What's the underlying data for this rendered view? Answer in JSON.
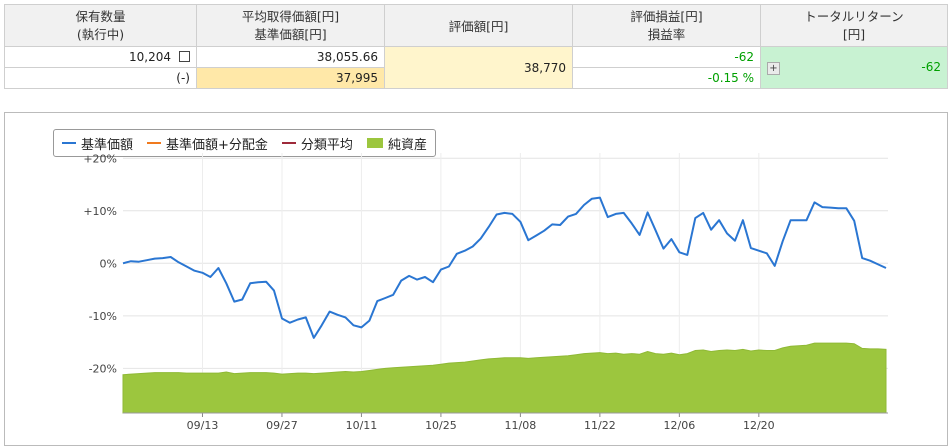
{
  "summary": {
    "headers": {
      "qty": [
        "保有数量",
        "(執行中)"
      ],
      "avg": [
        "平均取得価額[円]",
        "基準価額[円]"
      ],
      "valuation": "評価額[円]",
      "pl": [
        "評価損益[円]",
        "損益率"
      ],
      "total_return": [
        "トータルリターン",
        "[円]"
      ]
    },
    "qty": "10,204",
    "qty_pending": "(-)",
    "avg_cost": "38,055.66",
    "nav": "37,995",
    "valuation": "38,770",
    "pl": "-62",
    "pl_rate": "-0.15 %",
    "total_return": "-62",
    "colors": {
      "positive_text": "#00a000",
      "nav_bg": "#ffe8a8",
      "valuation_bg": "#fff5cc",
      "total_bg": "#c8f2d2"
    }
  },
  "chart_data": {
    "type": "line",
    "legend": [
      {
        "name": "基準価額",
        "color": "#2a76d2",
        "kind": "line"
      },
      {
        "name": "基準価額+分配金",
        "color": "#f07a1e",
        "kind": "line"
      },
      {
        "name": "分類平均",
        "color": "#9e2a3a",
        "kind": "line"
      },
      {
        "name": "純資産",
        "color": "#9cc63e",
        "kind": "area"
      }
    ],
    "y_ticks": [
      "+20%",
      "+10%",
      "0%",
      "-10%",
      "-20%"
    ],
    "ylim": [
      -28.5,
      21
    ],
    "x_ticks": [
      "09/13",
      "09/27",
      "10/11",
      "10/25",
      "11/08",
      "11/22",
      "12/06",
      "12/20"
    ],
    "x_tick_index": [
      10,
      20,
      30,
      40,
      50,
      60,
      70,
      80
    ],
    "grid": true,
    "legend_position": "top-left",
    "series": [
      {
        "name": "基準価額",
        "color": "#2a76d2",
        "values": [
          0.0,
          0.4,
          0.3,
          0.6,
          0.9,
          1.0,
          1.2,
          0.2,
          -0.6,
          -1.4,
          -1.8,
          -2.6,
          -0.9,
          -3.8,
          -7.3,
          -6.9,
          -3.8,
          -3.6,
          -3.5,
          -5.2,
          -10.5,
          -11.3,
          -10.7,
          -10.3,
          -14.2,
          -11.8,
          -9.2,
          -9.8,
          -10.3,
          -11.8,
          -12.2,
          -10.9,
          -7.2,
          -6.6,
          -6.0,
          -3.3,
          -2.4,
          -3.1,
          -2.6,
          -3.6,
          -1.2,
          -0.6,
          1.8,
          2.4,
          3.2,
          4.7,
          6.9,
          9.3,
          9.6,
          9.4,
          7.9,
          4.4,
          5.3,
          6.2,
          7.4,
          7.3,
          8.9,
          9.4,
          11.1,
          12.3,
          12.5,
          8.8,
          9.4,
          9.6,
          7.6,
          5.4,
          9.7,
          6.3,
          2.8,
          4.6,
          2.1,
          1.6,
          8.6,
          9.6,
          6.4,
          8.2,
          5.7,
          4.3,
          8.2,
          2.9,
          2.4,
          1.9,
          -0.5,
          4.2,
          8.2,
          8.2,
          8.2,
          11.6,
          10.7,
          10.6,
          10.5,
          10.5,
          8.1,
          1.0,
          0.5,
          -0.2,
          -0.9
        ]
      },
      {
        "name": "純資産",
        "color": "#9cc63e",
        "kind": "area",
        "values": [
          -21.2,
          -21.1,
          -21.0,
          -20.9,
          -20.8,
          -20.8,
          -20.8,
          -20.8,
          -20.9,
          -20.9,
          -20.9,
          -20.9,
          -20.9,
          -20.7,
          -21.0,
          -20.9,
          -20.8,
          -20.8,
          -20.8,
          -20.9,
          -21.1,
          -21.0,
          -20.9,
          -20.9,
          -21.0,
          -20.9,
          -20.8,
          -20.7,
          -20.6,
          -20.7,
          -20.6,
          -20.4,
          -20.2,
          -20.0,
          -19.9,
          -19.8,
          -19.7,
          -19.6,
          -19.5,
          -19.4,
          -19.2,
          -19.0,
          -18.9,
          -18.8,
          -18.6,
          -18.4,
          -18.2,
          -18.1,
          -18.0,
          -18.0,
          -18.0,
          -18.1,
          -18.0,
          -17.9,
          -17.8,
          -17.7,
          -17.6,
          -17.4,
          -17.2,
          -17.1,
          -17.0,
          -17.2,
          -17.1,
          -17.3,
          -17.2,
          -17.3,
          -16.8,
          -17.2,
          -17.3,
          -17.1,
          -17.4,
          -17.2,
          -16.6,
          -16.5,
          -16.8,
          -16.6,
          -16.5,
          -16.6,
          -16.4,
          -16.7,
          -16.5,
          -16.6,
          -16.6,
          -16.1,
          -15.8,
          -15.7,
          -15.6,
          -15.2,
          -15.2,
          -15.2,
          -15.2,
          -15.2,
          -15.3,
          -16.2,
          -16.3,
          -16.3,
          -16.4
        ]
      }
    ]
  }
}
